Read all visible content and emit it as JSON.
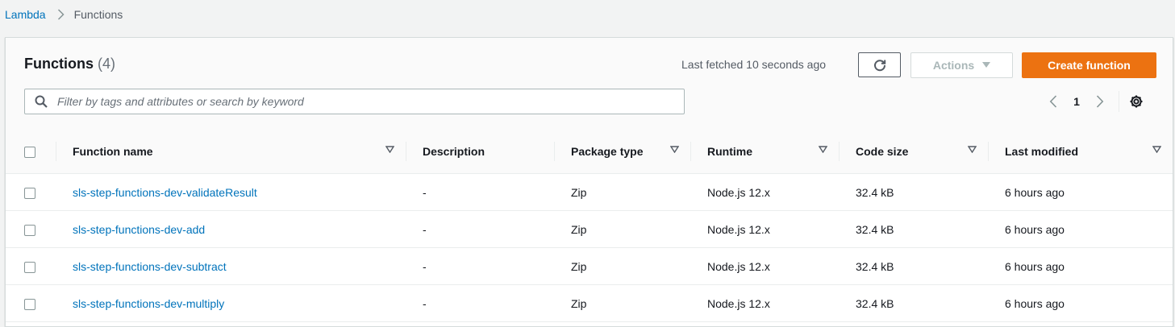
{
  "breadcrumb": {
    "root": "Lambda",
    "current": "Functions"
  },
  "header": {
    "title": "Functions",
    "count": "(4)",
    "fetched": "Last fetched 10 seconds ago",
    "actions_label": "Actions",
    "create_label": "Create function"
  },
  "search": {
    "placeholder": "Filter by tags and attributes or search by keyword",
    "value": ""
  },
  "pagination": {
    "page": "1"
  },
  "columns": [
    {
      "label": "Function name"
    },
    {
      "label": "Description"
    },
    {
      "label": "Package type"
    },
    {
      "label": "Runtime"
    },
    {
      "label": "Code size"
    },
    {
      "label": "Last modified"
    }
  ],
  "rows": [
    {
      "name": "sls-step-functions-dev-validateResult",
      "description": "-",
      "package": "Zip",
      "runtime": "Node.js 12.x",
      "size": "32.4 kB",
      "modified": "6 hours ago"
    },
    {
      "name": "sls-step-functions-dev-add",
      "description": "-",
      "package": "Zip",
      "runtime": "Node.js 12.x",
      "size": "32.4 kB",
      "modified": "6 hours ago"
    },
    {
      "name": "sls-step-functions-dev-subtract",
      "description": "-",
      "package": "Zip",
      "runtime": "Node.js 12.x",
      "size": "32.4 kB",
      "modified": "6 hours ago"
    },
    {
      "name": "sls-step-functions-dev-multiply",
      "description": "-",
      "package": "Zip",
      "runtime": "Node.js 12.x",
      "size": "32.4 kB",
      "modified": "6 hours ago"
    }
  ],
  "colors": {
    "link": "#0073bb",
    "primary": "#ec7211",
    "text": "#16191f",
    "muted": "#545b64"
  },
  "icons": {
    "refresh": "refresh-icon",
    "caret": "caret-down-icon",
    "search": "search-icon",
    "prev": "chevron-left-icon",
    "next": "chevron-right-icon",
    "settings": "gear-icon",
    "breadcrumb_sep": "chevron-right-icon",
    "sort": "sort-down-icon"
  }
}
